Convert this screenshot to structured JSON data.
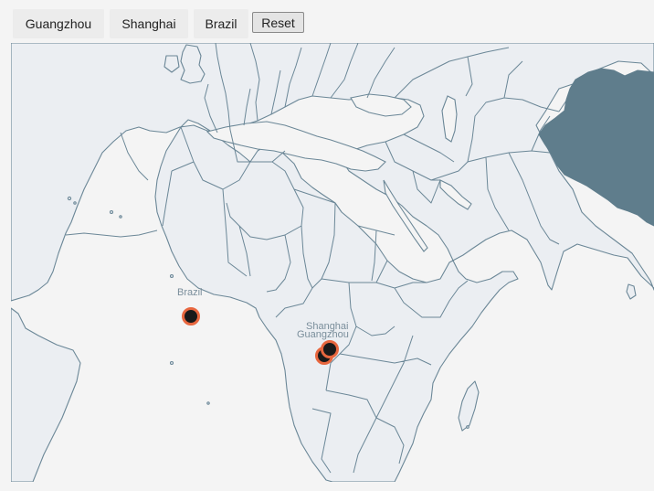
{
  "toolbar": {
    "buttons": [
      "Guangzhou",
      "Shanghai",
      "Brazil"
    ],
    "reset_label": "Reset"
  },
  "map": {
    "highlighted_country": "China",
    "colors": {
      "land": "#ebeef2",
      "border": "#6b8797",
      "highlight": "#5f7d8c",
      "marker_fill": "#1a1a1a",
      "marker_stroke": "#e8673f"
    },
    "markers": [
      {
        "label": "Brazil"
      },
      {
        "label": "Shanghai"
      },
      {
        "label": "Guangzhou"
      }
    ]
  }
}
